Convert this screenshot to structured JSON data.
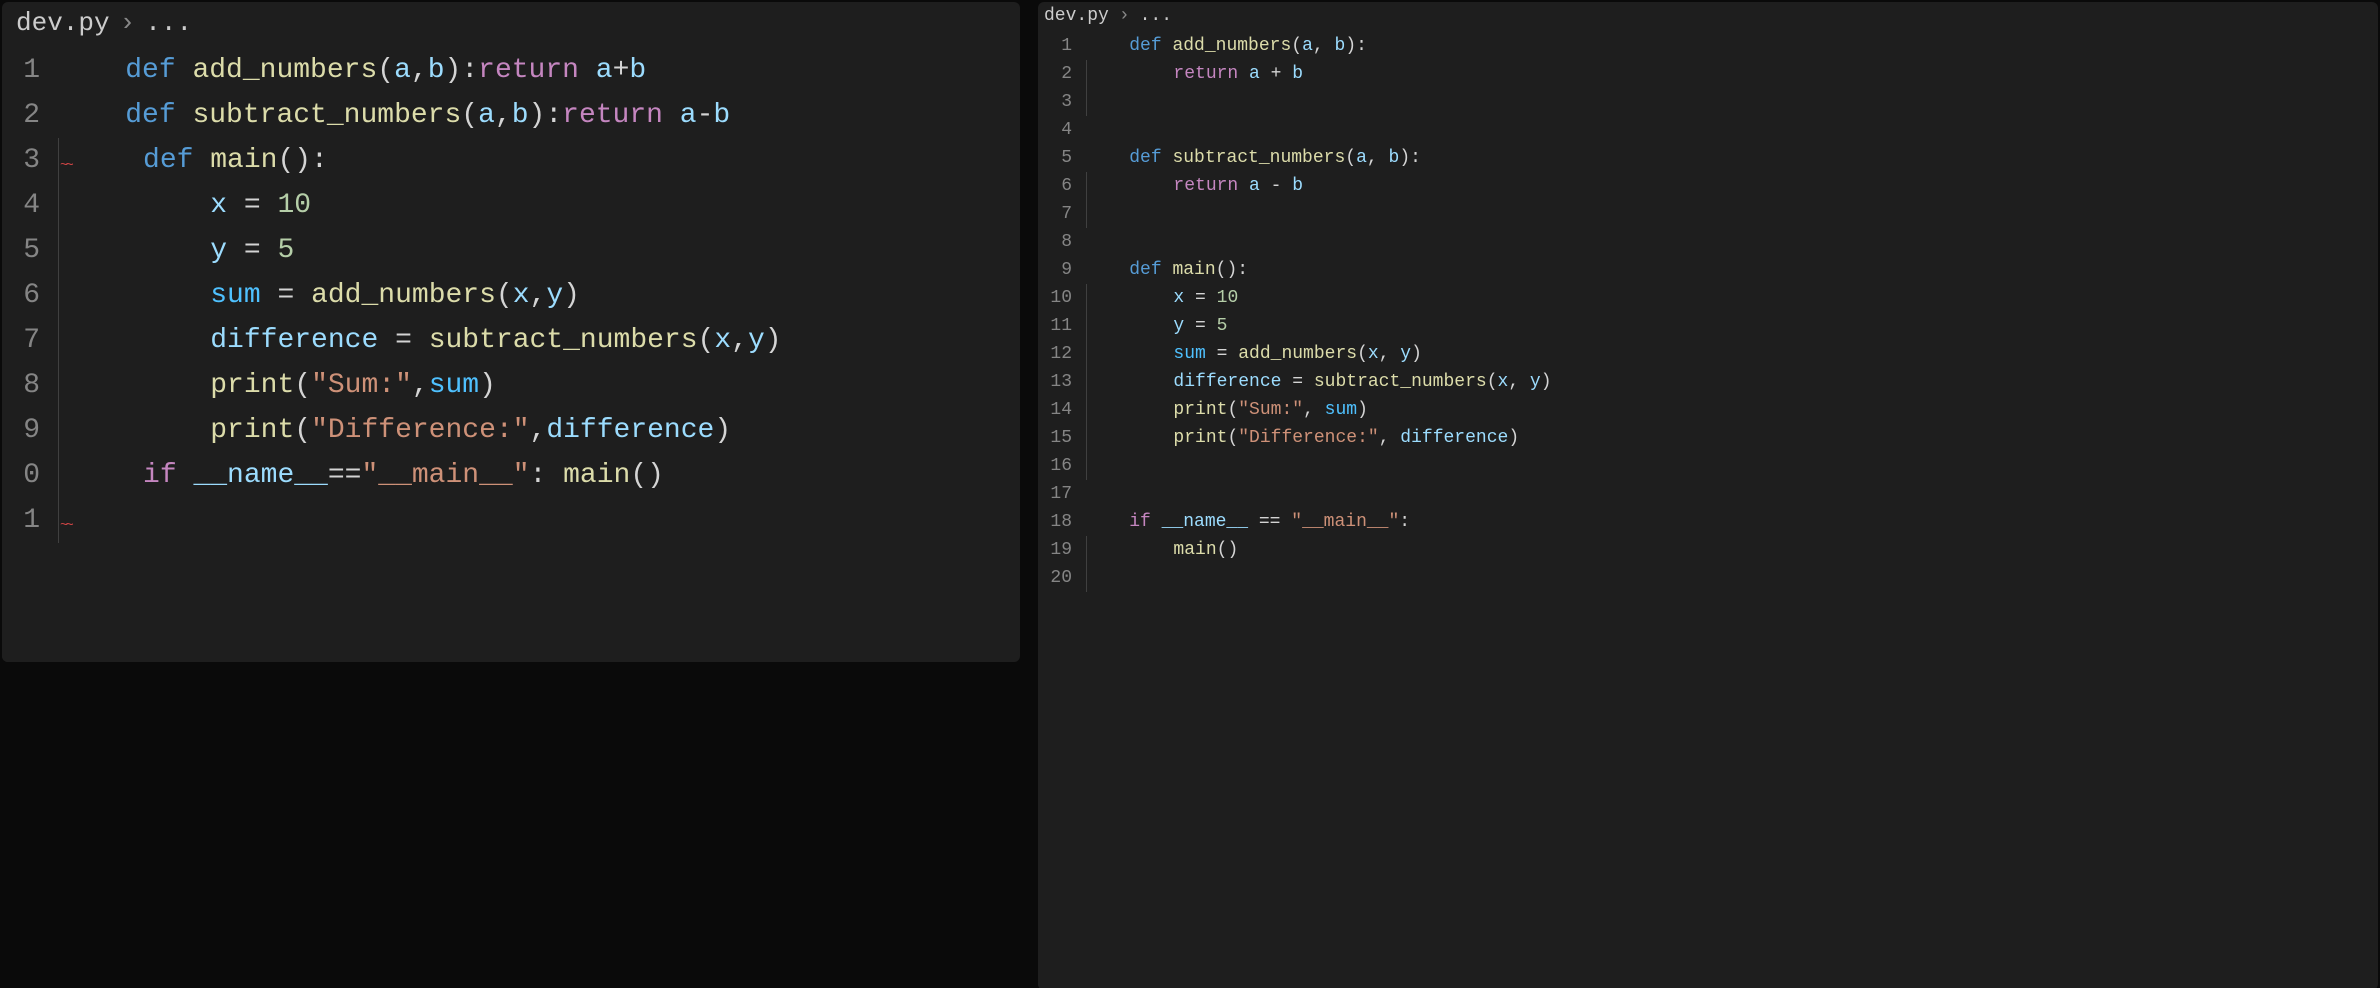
{
  "left": {
    "breadcrumb_file": "dev.py",
    "breadcrumb_sep": "›",
    "breadcrumb_tail": "...",
    "lines": [
      {
        "n": "1",
        "tokens": [
          [
            "kw",
            "def "
          ],
          [
            "fn",
            "add_numbers"
          ],
          [
            "fg",
            "("
          ],
          [
            "pm",
            "a"
          ],
          [
            "fg",
            ","
          ],
          [
            "pm",
            "b"
          ],
          [
            "fg",
            "):"
          ],
          [
            "ret",
            "return "
          ],
          [
            "pm",
            "a"
          ],
          [
            "fg",
            "+"
          ],
          [
            "pm",
            "b"
          ]
        ],
        "indent": 0,
        "pre": "    "
      },
      {
        "n": "2",
        "tokens": [
          [
            "kw",
            "def "
          ],
          [
            "fn",
            "subtract_numbers"
          ],
          [
            "fg",
            "("
          ],
          [
            "pm",
            "a"
          ],
          [
            "fg",
            ","
          ],
          [
            "pm",
            "b"
          ],
          [
            "fg",
            "):"
          ],
          [
            "ret",
            "return "
          ],
          [
            "pm",
            "a"
          ],
          [
            "fg",
            "-"
          ],
          [
            "pm",
            "b"
          ]
        ],
        "indent": 0,
        "pre": "    "
      },
      {
        "n": "3",
        "tokens": [
          [
            "kw",
            "def "
          ],
          [
            "fn",
            "main"
          ],
          [
            "fg",
            "():"
          ]
        ],
        "indent": 1,
        "pre": "     ",
        "squiggle": true
      },
      {
        "n": "4",
        "tokens": [
          [
            "pm",
            "x"
          ],
          [
            "fg",
            " = "
          ],
          [
            "num",
            "10"
          ]
        ],
        "indent": 1,
        "pre": "         "
      },
      {
        "n": "5",
        "tokens": [
          [
            "pm",
            "y"
          ],
          [
            "fg",
            " = "
          ],
          [
            "num",
            "5"
          ]
        ],
        "indent": 1,
        "pre": "         "
      },
      {
        "n": "6",
        "tokens": [
          [
            "cst",
            "sum"
          ],
          [
            "fg",
            " = "
          ],
          [
            "fn",
            "add_numbers"
          ],
          [
            "fg",
            "("
          ],
          [
            "pm",
            "x"
          ],
          [
            "fg",
            ","
          ],
          [
            "pm",
            "y"
          ],
          [
            "fg",
            ")"
          ]
        ],
        "indent": 1,
        "pre": "         "
      },
      {
        "n": "7",
        "tokens": [
          [
            "pm",
            "difference"
          ],
          [
            "fg",
            " = "
          ],
          [
            "fn",
            "subtract_numbers"
          ],
          [
            "fg",
            "("
          ],
          [
            "pm",
            "x"
          ],
          [
            "fg",
            ","
          ],
          [
            "pm",
            "y"
          ],
          [
            "fg",
            ")"
          ]
        ],
        "indent": 1,
        "pre": "         "
      },
      {
        "n": "8",
        "tokens": [
          [
            "fn",
            "print"
          ],
          [
            "fg",
            "("
          ],
          [
            "str",
            "\"Sum:\""
          ],
          [
            "fg",
            ","
          ],
          [
            "cst",
            "sum"
          ],
          [
            "fg",
            ")"
          ]
        ],
        "indent": 1,
        "pre": "         "
      },
      {
        "n": "9",
        "tokens": [
          [
            "fn",
            "print"
          ],
          [
            "fg",
            "("
          ],
          [
            "str",
            "\"Difference:\""
          ],
          [
            "fg",
            ","
          ],
          [
            "pm",
            "difference"
          ],
          [
            "fg",
            ")"
          ]
        ],
        "indent": 1,
        "pre": "         "
      },
      {
        "n": "0",
        "tokens": [
          [
            "ret",
            "if "
          ],
          [
            "pm",
            "__name__"
          ],
          [
            "fg",
            "=="
          ],
          [
            "str",
            "\"__main__\""
          ],
          [
            "fg",
            ": "
          ],
          [
            "fn",
            "main"
          ],
          [
            "fg",
            "()"
          ]
        ],
        "indent": 1,
        "pre": "     "
      },
      {
        "n": "1",
        "tokens": [],
        "indent": 1,
        "pre": "     ",
        "squiggle": true
      }
    ]
  },
  "right": {
    "breadcrumb_file": "dev.py",
    "breadcrumb_sep": "›",
    "breadcrumb_tail": "...",
    "lines": [
      {
        "n": "1",
        "tokens": [
          [
            "kw",
            "def "
          ],
          [
            "fn",
            "add_numbers"
          ],
          [
            "fg",
            "("
          ],
          [
            "pm",
            "a"
          ],
          [
            "fg",
            ", "
          ],
          [
            "pm",
            "b"
          ],
          [
            "fg",
            "):"
          ]
        ],
        "indent": 0,
        "pre": "    "
      },
      {
        "n": "2",
        "tokens": [
          [
            "ret",
            "return "
          ],
          [
            "pm",
            "a"
          ],
          [
            "fg",
            " + "
          ],
          [
            "pm",
            "b"
          ]
        ],
        "indent": 1,
        "pre": "        "
      },
      {
        "n": "3",
        "tokens": [],
        "indent": 1,
        "pre": "    "
      },
      {
        "n": "4",
        "tokens": [],
        "indent": 0,
        "pre": "    "
      },
      {
        "n": "5",
        "tokens": [
          [
            "kw",
            "def "
          ],
          [
            "fn",
            "subtract_numbers"
          ],
          [
            "fg",
            "("
          ],
          [
            "pm",
            "a"
          ],
          [
            "fg",
            ", "
          ],
          [
            "pm",
            "b"
          ],
          [
            "fg",
            "):"
          ]
        ],
        "indent": 0,
        "pre": "    "
      },
      {
        "n": "6",
        "tokens": [
          [
            "ret",
            "return "
          ],
          [
            "pm",
            "a"
          ],
          [
            "fg",
            " - "
          ],
          [
            "pm",
            "b"
          ]
        ],
        "indent": 1,
        "pre": "        "
      },
      {
        "n": "7",
        "tokens": [],
        "indent": 1,
        "pre": "    "
      },
      {
        "n": "8",
        "tokens": [],
        "indent": 0,
        "pre": "    "
      },
      {
        "n": "9",
        "tokens": [
          [
            "kw",
            "def "
          ],
          [
            "fn",
            "main"
          ],
          [
            "fg",
            "():"
          ]
        ],
        "indent": 0,
        "pre": "    "
      },
      {
        "n": "10",
        "tokens": [
          [
            "pm",
            "x"
          ],
          [
            "fg",
            " = "
          ],
          [
            "num",
            "10"
          ]
        ],
        "indent": 1,
        "pre": "        "
      },
      {
        "n": "11",
        "tokens": [
          [
            "pm",
            "y"
          ],
          [
            "fg",
            " = "
          ],
          [
            "num",
            "5"
          ]
        ],
        "indent": 1,
        "pre": "        "
      },
      {
        "n": "12",
        "tokens": [
          [
            "cst",
            "sum"
          ],
          [
            "fg",
            " = "
          ],
          [
            "fn",
            "add_numbers"
          ],
          [
            "fg",
            "("
          ],
          [
            "pm",
            "x"
          ],
          [
            "fg",
            ", "
          ],
          [
            "pm",
            "y"
          ],
          [
            "fg",
            ")"
          ]
        ],
        "indent": 1,
        "pre": "        "
      },
      {
        "n": "13",
        "tokens": [
          [
            "pm",
            "difference"
          ],
          [
            "fg",
            " = "
          ],
          [
            "fn",
            "subtract_numbers"
          ],
          [
            "fg",
            "("
          ],
          [
            "pm",
            "x"
          ],
          [
            "fg",
            ", "
          ],
          [
            "pm",
            "y"
          ],
          [
            "fg",
            ")"
          ]
        ],
        "indent": 1,
        "pre": "        "
      },
      {
        "n": "14",
        "tokens": [
          [
            "fn",
            "print"
          ],
          [
            "fg",
            "("
          ],
          [
            "str",
            "\"Sum:\""
          ],
          [
            "fg",
            ", "
          ],
          [
            "cst",
            "sum"
          ],
          [
            "fg",
            ")"
          ]
        ],
        "indent": 1,
        "pre": "        "
      },
      {
        "n": "15",
        "tokens": [
          [
            "fn",
            "print"
          ],
          [
            "fg",
            "("
          ],
          [
            "str",
            "\"Difference:\""
          ],
          [
            "fg",
            ", "
          ],
          [
            "pm",
            "difference"
          ],
          [
            "fg",
            ")"
          ]
        ],
        "indent": 1,
        "pre": "        "
      },
      {
        "n": "16",
        "tokens": [],
        "indent": 1,
        "pre": "    "
      },
      {
        "n": "17",
        "tokens": [],
        "indent": 0,
        "pre": "    "
      },
      {
        "n": "18",
        "tokens": [
          [
            "ret",
            "if "
          ],
          [
            "pm",
            "__name__"
          ],
          [
            "fg",
            " == "
          ],
          [
            "str",
            "\"__main__\""
          ],
          [
            "fg",
            ":"
          ]
        ],
        "indent": 0,
        "pre": "    "
      },
      {
        "n": "19",
        "tokens": [
          [
            "fn",
            "main"
          ],
          [
            "fg",
            "()"
          ]
        ],
        "indent": 1,
        "pre": "        "
      },
      {
        "n": "20",
        "tokens": [],
        "indent": 1,
        "pre": "    "
      }
    ]
  }
}
